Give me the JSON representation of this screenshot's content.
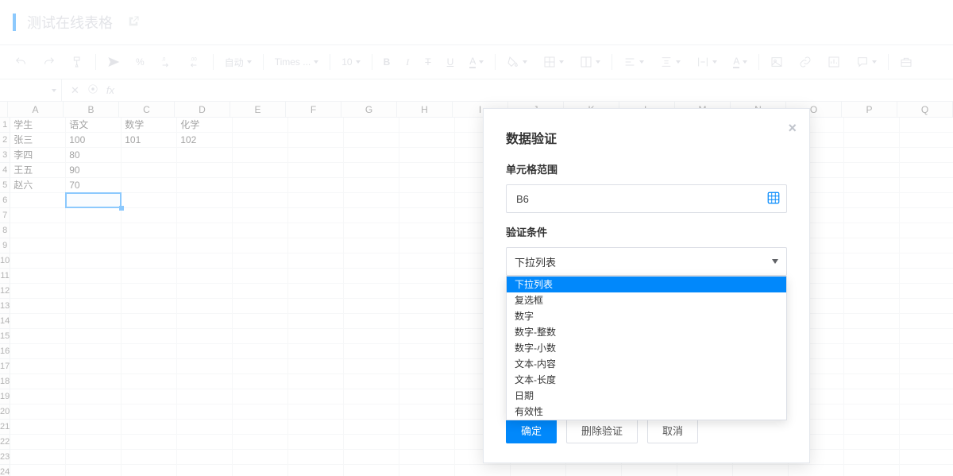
{
  "header": {
    "title": "测试在线表格"
  },
  "toolbar": {
    "auto_label": "自动",
    "font_family": "Times ...",
    "font_size": "10",
    "bold_glyph": "B",
    "italic_glyph": "I",
    "strike_glyph": "T",
    "underline_glyph": "U",
    "textcolor_glyph": "A",
    "bgcolor_glyph": "A"
  },
  "formula_bar": {
    "name_box_value": "",
    "fx_label": "fx"
  },
  "columns": [
    "A",
    "B",
    "C",
    "D",
    "E",
    "F",
    "G",
    "H",
    "I",
    "J",
    "K",
    "L",
    "M",
    "N",
    "O",
    "P",
    "Q"
  ],
  "rows": [
    "1",
    "2",
    "3",
    "4",
    "5",
    "6",
    "7",
    "8",
    "9",
    "10",
    "11",
    "12",
    "13",
    "14",
    "15",
    "16",
    "17",
    "18",
    "19",
    "20",
    "21",
    "22",
    "23",
    "24"
  ],
  "grid": [
    [
      "学生",
      "语文",
      "数学",
      "化学",
      "",
      "",
      "",
      "",
      "",
      "",
      "",
      "",
      "",
      "",
      "",
      "",
      ""
    ],
    [
      "张三",
      "100",
      "101",
      "102",
      "",
      "",
      "",
      "",
      "",
      "",
      "",
      "",
      "",
      "",
      "",
      "",
      ""
    ],
    [
      "李四",
      "80",
      "",
      "",
      "",
      "",
      "",
      "",
      "",
      "",
      "",
      "",
      "",
      "",
      "",
      "",
      ""
    ],
    [
      "王五",
      "90",
      "",
      "",
      "",
      "",
      "",
      "",
      "",
      "",
      "",
      "",
      "",
      "",
      "",
      "",
      ""
    ],
    [
      "赵六",
      "70",
      "",
      "",
      "",
      "",
      "",
      "",
      "",
      "",
      "",
      "",
      "",
      "",
      "",
      "",
      ""
    ],
    [
      "",
      "",
      "",
      "",
      "",
      "",
      "",
      "",
      "",
      "",
      "",
      "",
      "",
      "",
      "",
      "",
      ""
    ],
    [
      "",
      "",
      "",
      "",
      "",
      "",
      "",
      "",
      "",
      "",
      "",
      "",
      "",
      "",
      "",
      "",
      ""
    ],
    [
      "",
      "",
      "",
      "",
      "",
      "",
      "",
      "",
      "",
      "",
      "",
      "",
      "",
      "",
      "",
      "",
      ""
    ],
    [
      "",
      "",
      "",
      "",
      "",
      "",
      "",
      "",
      "",
      "",
      "",
      "",
      "",
      "",
      "",
      "",
      ""
    ],
    [
      "",
      "",
      "",
      "",
      "",
      "",
      "",
      "",
      "",
      "",
      "",
      "",
      "",
      "",
      "",
      "",
      ""
    ],
    [
      "",
      "",
      "",
      "",
      "",
      "",
      "",
      "",
      "",
      "",
      "",
      "",
      "",
      "",
      "",
      "",
      ""
    ],
    [
      "",
      "",
      "",
      "",
      "",
      "",
      "",
      "",
      "",
      "",
      "",
      "",
      "",
      "",
      "",
      "",
      ""
    ],
    [
      "",
      "",
      "",
      "",
      "",
      "",
      "",
      "",
      "",
      "",
      "",
      "",
      "",
      "",
      "",
      "",
      ""
    ],
    [
      "",
      "",
      "",
      "",
      "",
      "",
      "",
      "",
      "",
      "",
      "",
      "",
      "",
      "",
      "",
      "",
      ""
    ],
    [
      "",
      "",
      "",
      "",
      "",
      "",
      "",
      "",
      "",
      "",
      "",
      "",
      "",
      "",
      "",
      "",
      ""
    ],
    [
      "",
      "",
      "",
      "",
      "",
      "",
      "",
      "",
      "",
      "",
      "",
      "",
      "",
      "",
      "",
      "",
      ""
    ],
    [
      "",
      "",
      "",
      "",
      "",
      "",
      "",
      "",
      "",
      "",
      "",
      "",
      "",
      "",
      "",
      "",
      ""
    ],
    [
      "",
      "",
      "",
      "",
      "",
      "",
      "",
      "",
      "",
      "",
      "",
      "",
      "",
      "",
      "",
      "",
      ""
    ],
    [
      "",
      "",
      "",
      "",
      "",
      "",
      "",
      "",
      "",
      "",
      "",
      "",
      "",
      "",
      "",
      "",
      ""
    ],
    [
      "",
      "",
      "",
      "",
      "",
      "",
      "",
      "",
      "",
      "",
      "",
      "",
      "",
      "",
      "",
      "",
      ""
    ],
    [
      "",
      "",
      "",
      "",
      "",
      "",
      "",
      "",
      "",
      "",
      "",
      "",
      "",
      "",
      "",
      "",
      ""
    ],
    [
      "",
      "",
      "",
      "",
      "",
      "",
      "",
      "",
      "",
      "",
      "",
      "",
      "",
      "",
      "",
      "",
      ""
    ],
    [
      "",
      "",
      "",
      "",
      "",
      "",
      "",
      "",
      "",
      "",
      "",
      "",
      "",
      "",
      "",
      "",
      ""
    ],
    [
      "",
      "",
      "",
      "",
      "",
      "",
      "",
      "",
      "",
      "",
      "",
      "",
      "",
      "",
      "",
      "",
      ""
    ]
  ],
  "selection": {
    "cell_ref": "B6"
  },
  "modal": {
    "title": "数据验证",
    "range_label": "单元格范围",
    "range_value": "B6",
    "condition_label": "验证条件",
    "selected_option": "下拉列表",
    "options": [
      "下拉列表",
      "复选框",
      "数字",
      "数字-整数",
      "数字-小数",
      "文本-内容",
      "文本-长度",
      "日期",
      "有效性"
    ],
    "ok_label": "确定",
    "delete_label": "删除验证",
    "cancel_label": "取消"
  }
}
